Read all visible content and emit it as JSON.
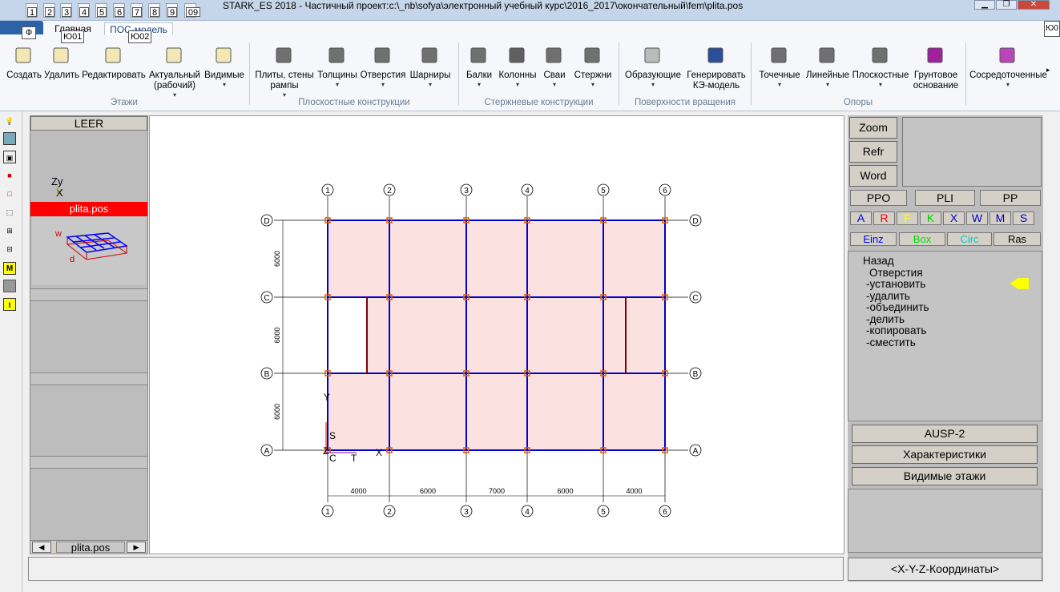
{
  "window": {
    "title": "STARK_ES 2018 - Частичный проект:c:\\_nb\\sofya\\электронный учебный курс\\2016_2017\\окончательный\\fem\\plita.pos",
    "quick_access_keys": [
      "1",
      "2",
      "3",
      "4",
      "5",
      "6",
      "7",
      "8",
      "9",
      "09"
    ],
    "minimize": "▁",
    "restore": "❐",
    "close": "✕",
    "edge_key": "Ю0"
  },
  "ribbon": {
    "file_key": "Ф",
    "tabs": [
      {
        "label": "Главная",
        "key": "Ю01"
      },
      {
        "label": "ПОС-модель",
        "key": "Ю02"
      }
    ],
    "buttons": [
      {
        "label": "Создать",
        "icon": "floor-create-icon"
      },
      {
        "label": "Удалить",
        "icon": "floor-delete-icon"
      },
      {
        "label": "Редактировать",
        "icon": "floor-edit-icon"
      },
      {
        "label": "Актуальный\n(рабочий)",
        "icon": "floor-current-icon"
      },
      {
        "label": "Видимые",
        "icon": "floor-visible-icon"
      },
      {
        "label": "Плиты, стены\nрампы",
        "icon": "slab-icon"
      },
      {
        "label": "Толщины",
        "icon": "thickness-icon"
      },
      {
        "label": "Отверстия",
        "icon": "opening-icon"
      },
      {
        "label": "Шарниры",
        "icon": "hinge-icon"
      },
      {
        "label": "Балки",
        "icon": "beam-icon"
      },
      {
        "label": "Колонны",
        "icon": "column-icon"
      },
      {
        "label": "Сваи",
        "icon": "pile-icon"
      },
      {
        "label": "Стержни",
        "icon": "rod-icon"
      },
      {
        "label": "Образующие",
        "icon": "cone-icon"
      },
      {
        "label": "Генерировать\nКЭ-модель",
        "icon": "mesh-icon"
      },
      {
        "label": "Точечные",
        "icon": "point-support-icon"
      },
      {
        "label": "Линейные",
        "icon": "line-support-icon"
      },
      {
        "label": "Плоскостные",
        "icon": "area-support-icon"
      },
      {
        "label": "Грунтовое\nоснование",
        "icon": "soil-icon"
      },
      {
        "label": "Сосредоточенные",
        "icon": "point-load-icon"
      }
    ],
    "groups": [
      "Этажи",
      "Плоскостные конструкции",
      "Стержневые конструкции",
      "Поверхности вращения",
      "Опоры"
    ]
  },
  "left_panel": {
    "header": "LEER",
    "axis_label": "Zy\nX",
    "active_file": "plita.pos",
    "nav_prev": "◀",
    "nav_next": "▶",
    "nav_file": "plita.pos"
  },
  "drawing": {
    "axes_x": [
      "1",
      "2",
      "3",
      "4",
      "5",
      "6"
    ],
    "axes_y": [
      "D",
      "C",
      "B",
      "A"
    ],
    "dims_x": [
      "4000",
      "6000",
      "7000",
      "6000",
      "4000"
    ],
    "dims_y": [
      "6000",
      "6000",
      "6000"
    ],
    "origin_labels": {
      "y": "Y",
      "s": "S",
      "z": "Z",
      "c": "C",
      "t": "T",
      "x": "X"
    },
    "colors": {
      "slab": "#fce1e1",
      "beam": "#0000cc",
      "wall": "#800000",
      "grid": "#000000",
      "node": "#e05a00"
    }
  },
  "right_panel": {
    "zoom": "Zoom",
    "refr": "Refr",
    "word": "Word",
    "tabs": [
      "PPO",
      "PLI",
      "PP"
    ],
    "letters": [
      {
        "t": "A",
        "c": "#0000ff"
      },
      {
        "t": "R",
        "c": "#ff0000"
      },
      {
        "t": "F",
        "c": "#ffff00"
      },
      {
        "t": "K",
        "c": "#00cc00"
      },
      {
        "t": "X",
        "c": "#0000cc"
      },
      {
        "t": "W",
        "c": "#0000cc"
      },
      {
        "t": "M",
        "c": "#0000cc"
      },
      {
        "t": "S",
        "c": "#0000cc"
      }
    ],
    "switches": [
      {
        "t": "Einz",
        "c": "#0000ff"
      },
      {
        "t": "Box",
        "c": "#00dd00"
      },
      {
        "t": "Circ",
        "c": "#00cccc"
      },
      {
        "t": "Ras",
        "c": "#000000"
      }
    ],
    "menu": [
      "Назад",
      "Отверстия",
      "-установить",
      "-удалить",
      "-объединить",
      "-делить",
      "-копировать",
      "-сместить"
    ],
    "ausp": "AUSP-2",
    "characteristics": "Характеристики",
    "visible_floors": "Видимые этажи",
    "coords": "<X-Y-Z-Координаты>"
  }
}
